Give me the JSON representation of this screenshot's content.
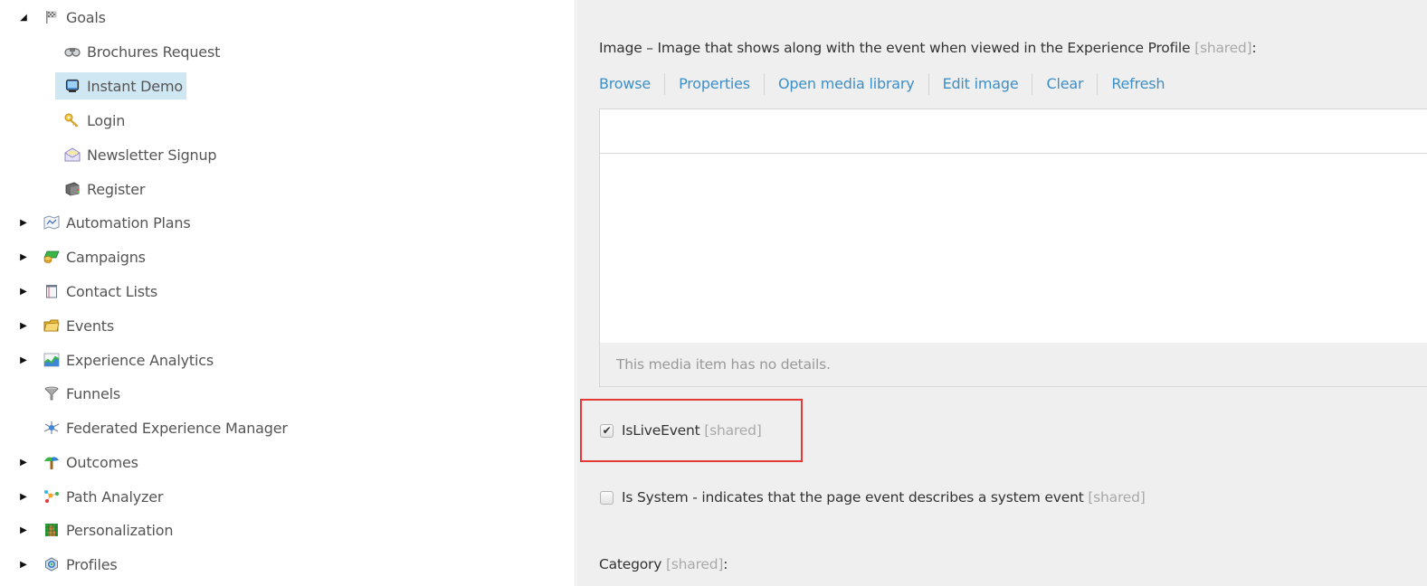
{
  "tree": {
    "items": [
      {
        "label": "Goals",
        "level": 0,
        "toggle": "expanded",
        "icon": "flag-icon"
      },
      {
        "label": "Brochures Request",
        "level": 1,
        "toggle": "none",
        "icon": "binoculars-icon"
      },
      {
        "label": "Instant Demo",
        "level": 1,
        "toggle": "none",
        "icon": "monitor-icon",
        "selected": true
      },
      {
        "label": "Login",
        "level": 1,
        "toggle": "none",
        "icon": "key-icon"
      },
      {
        "label": "Newsletter Signup",
        "level": 1,
        "toggle": "none",
        "icon": "envelope-icon"
      },
      {
        "label": "Register",
        "level": 1,
        "toggle": "none",
        "icon": "book-icon"
      },
      {
        "label": "Automation Plans",
        "level": 0,
        "toggle": "collapsed",
        "icon": "map-icon"
      },
      {
        "label": "Campaigns",
        "level": 0,
        "toggle": "collapsed",
        "icon": "money-icon"
      },
      {
        "label": "Contact Lists",
        "level": 0,
        "toggle": "collapsed",
        "icon": "notepad-icon"
      },
      {
        "label": "Events",
        "level": 0,
        "toggle": "collapsed",
        "icon": "folder-icon"
      },
      {
        "label": "Experience Analytics",
        "level": 0,
        "toggle": "collapsed",
        "icon": "chart-icon"
      },
      {
        "label": "Funnels",
        "level": 0,
        "toggle": "none",
        "icon": "funnel-icon"
      },
      {
        "label": "Federated Experience Manager",
        "level": 0,
        "toggle": "none",
        "icon": "network-icon"
      },
      {
        "label": "Outcomes",
        "level": 0,
        "toggle": "collapsed",
        "icon": "signpost-icon"
      },
      {
        "label": "Path Analyzer",
        "level": 0,
        "toggle": "collapsed",
        "icon": "nodes-icon"
      },
      {
        "label": "Personalization",
        "level": 0,
        "toggle": "collapsed",
        "icon": "grid-person-icon"
      },
      {
        "label": "Profiles",
        "level": 0,
        "toggle": "collapsed",
        "icon": "profile-cube-icon"
      }
    ]
  },
  "editor": {
    "image_field": {
      "label": "Image – Image that shows along with the event when viewed in the Experience Profile",
      "shared_tag": "[shared]",
      "suffix": ":",
      "links": [
        "Browse",
        "Properties",
        "Open media library",
        "Edit image",
        "Clear",
        "Refresh"
      ],
      "details_text": "This media item has no details."
    },
    "is_live_event": {
      "label": "IsLiveEvent",
      "shared_tag": "[shared]",
      "checked": true
    },
    "is_system": {
      "label": "Is System - indicates that the page event describes a system event",
      "shared_tag": "[shared]",
      "checked": false
    },
    "category": {
      "label": "Category",
      "shared_tag": "[shared]",
      "suffix": ":"
    }
  },
  "colors": {
    "link": "#3d8fc7",
    "selection": "#cfe7f3",
    "highlight_border": "#e53935",
    "panel_bg": "#efefef"
  }
}
